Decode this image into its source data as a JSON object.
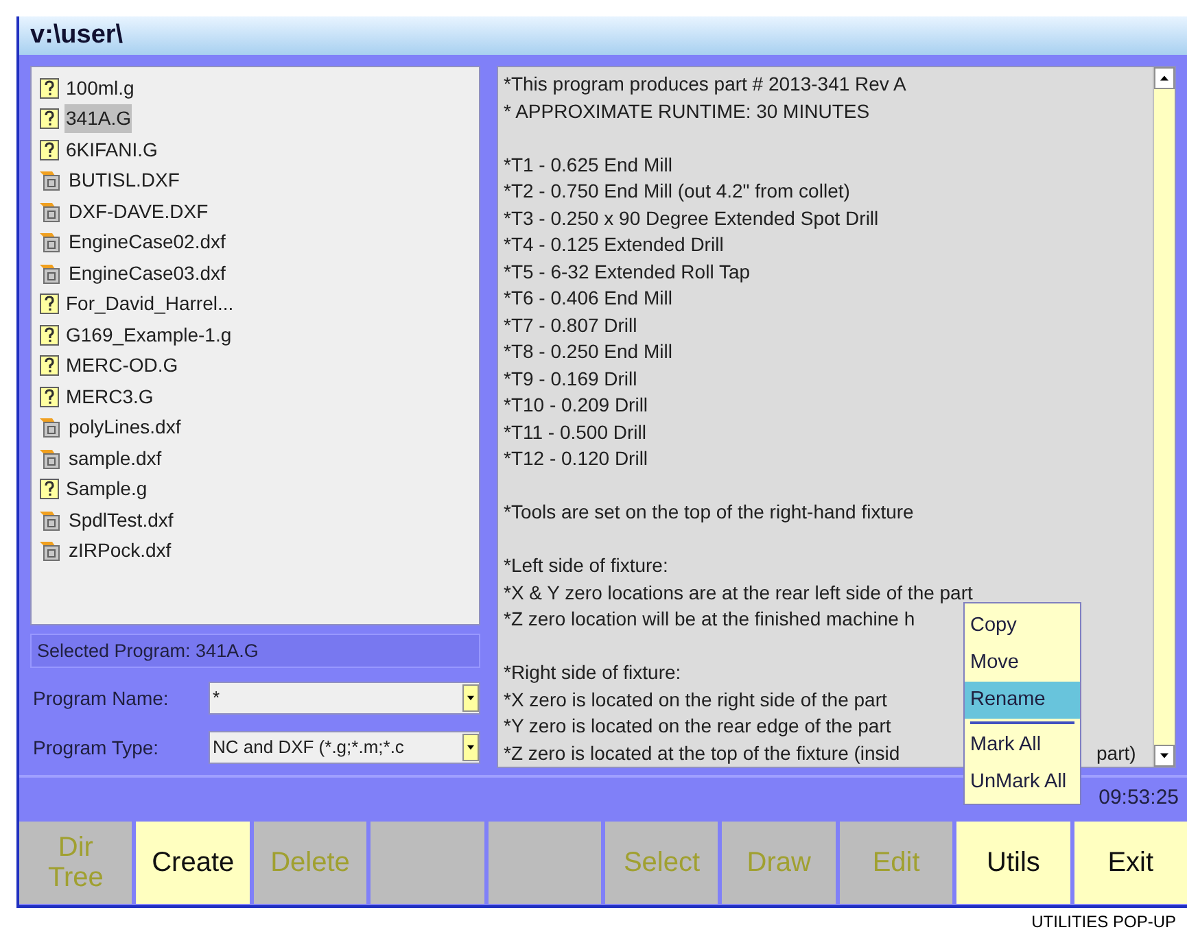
{
  "window": {
    "title": "v:\\user\\"
  },
  "files": [
    {
      "name": "100ml.g",
      "kind": "g",
      "selected": false
    },
    {
      "name": "341A.G",
      "kind": "g",
      "selected": true
    },
    {
      "name": "6KIFANI.G",
      "kind": "g",
      "selected": false
    },
    {
      "name": "BUTISL.DXF",
      "kind": "dxf",
      "selected": false
    },
    {
      "name": "DXF-DAVE.DXF",
      "kind": "dxf",
      "selected": false
    },
    {
      "name": "EngineCase02.dxf",
      "kind": "dxf",
      "selected": false
    },
    {
      "name": "EngineCase03.dxf",
      "kind": "dxf",
      "selected": false
    },
    {
      "name": "For_David_Harrel...",
      "kind": "g",
      "selected": false
    },
    {
      "name": "G169_Example-1.g",
      "kind": "g",
      "selected": false
    },
    {
      "name": "MERC-OD.G",
      "kind": "g",
      "selected": false
    },
    {
      "name": "MERC3.G",
      "kind": "g",
      "selected": false
    },
    {
      "name": "polyLines.dxf",
      "kind": "dxf",
      "selected": false
    },
    {
      "name": "sample.dxf",
      "kind": "dxf",
      "selected": false
    },
    {
      "name": "Sample.g",
      "kind": "g",
      "selected": false
    },
    {
      "name": "SpdlTest.dxf",
      "kind": "dxf",
      "selected": false
    },
    {
      "name": "zIRPock.dxf",
      "kind": "dxf",
      "selected": false
    }
  ],
  "selected_program": "Selected Program: 341A.G",
  "fields": [
    {
      "label": "Program Name:",
      "value": "*"
    },
    {
      "label": "Program Type:",
      "value": "NC and DXF (*.g;*.m;*.c"
    }
  ],
  "program_text": [
    {
      "lines": [
        {
          "text": "*This program produces part # 2013-341 Rev A"
        },
        {
          "text": "* APPROXIMATE RUNTIME: 30 MINUTES"
        }
      ]
    },
    {
      "lines": [
        {
          "text": "*T1 - 0.625 End Mill"
        },
        {
          "text": "*T2 - 0.750 End Mill (out 4.2\" from collet)"
        },
        {
          "text": "*T3 - 0.250 x 90 Degree Extended Spot Drill"
        },
        {
          "text": "*T4 - 0.125 Extended Drill"
        },
        {
          "text": "*T5 - 6-32 Extended Roll Tap"
        },
        {
          "text": "*T6 - 0.406 End Mill"
        },
        {
          "text": "*T7 - 0.807 Drill"
        },
        {
          "text": "*T8 - 0.250 End Mill"
        },
        {
          "text": "*T9 - 0.169 Drill"
        },
        {
          "text": "*T10 - 0.209 Drill"
        },
        {
          "text": "*T11 - 0.500 Drill"
        },
        {
          "text": "*T12 - 0.120 Drill"
        }
      ]
    },
    {
      "lines": [
        {
          "text": "*Tools are set on the top of the right-hand fixture"
        }
      ]
    },
    {
      "lines": [
        {
          "text": "*Left side of fixture:"
        },
        {
          "text": "*X & Y zero locations are at the rear left side of the part"
        },
        {
          "text": "*Z zero location will be at the finished machine h"
        }
      ]
    },
    {
      "lines": [
        {
          "text": "*Right side of fixture:"
        },
        {
          "text": "*X zero is located on the right side of the part"
        },
        {
          "text": "*Y zero is located on the rear edge of the part"
        },
        {
          "text": "*Z zero is located at the top of the fixture (insid",
          "tail": "part)"
        }
      ]
    }
  ],
  "popup_menu": [
    {
      "label": "Copy",
      "kind": "item",
      "selected": false
    },
    {
      "label": "Move",
      "kind": "item",
      "selected": false
    },
    {
      "label": "Rename",
      "kind": "item",
      "selected": true
    },
    {
      "kind": "separator"
    },
    {
      "label": "Mark All",
      "kind": "item",
      "selected": false
    },
    {
      "label": "UnMark All",
      "kind": "item",
      "selected": false
    }
  ],
  "status_bar": {
    "time": "09:53:25"
  },
  "buttons": [
    {
      "label": "Dir Tree",
      "disabled": true
    },
    {
      "label": "Create",
      "disabled": false
    },
    {
      "label": "Delete",
      "disabled": true
    },
    {
      "disabled": true
    },
    {
      "disabled": true
    },
    {
      "label": "Select",
      "disabled": true
    },
    {
      "label": "Draw",
      "disabled": true
    },
    {
      "label": "Edit",
      "disabled": true
    },
    {
      "label": "Utils",
      "disabled": false
    },
    {
      "label": "Exit",
      "disabled": false
    }
  ],
  "caption": "UTILITIES POP-UP"
}
